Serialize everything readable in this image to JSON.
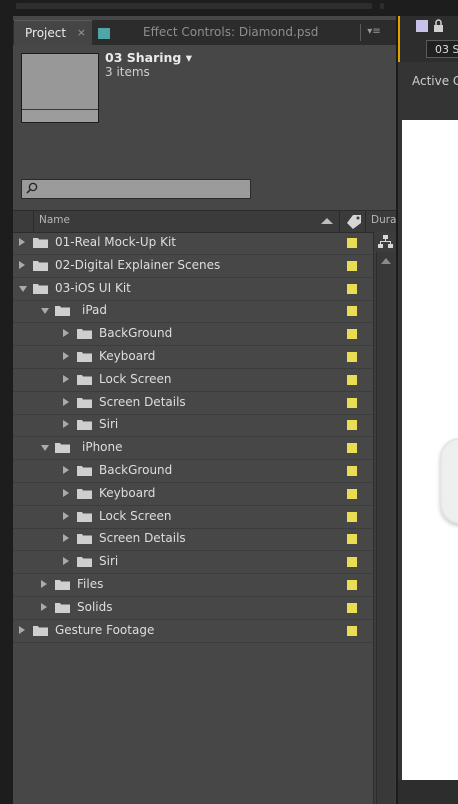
{
  "tabs": {
    "project": "Project",
    "project_close": "×",
    "effect_controls": "Effect Controls: Diamond.psd",
    "menu": "▾≡"
  },
  "composition": {
    "name": "03 Sharing ▾",
    "items": "3 items"
  },
  "search": {
    "placeholder": ""
  },
  "columns": {
    "name": "Name",
    "duration": "Dura"
  },
  "rows": [
    {
      "label": "01-Real Mock-Up Kit",
      "level": 0,
      "expanded": false
    },
    {
      "label": "02-Digital Explainer Scenes",
      "level": 0,
      "expanded": false
    },
    {
      "label": "03-iOS UI Kit",
      "level": 0,
      "expanded": true
    },
    {
      "label": "iPad",
      "level": 1,
      "expanded": true
    },
    {
      "label": "BackGround",
      "level": 2,
      "expanded": false
    },
    {
      "label": "Keyboard",
      "level": 2,
      "expanded": false
    },
    {
      "label": "Lock Screen",
      "level": 2,
      "expanded": false
    },
    {
      "label": "Screen Details",
      "level": 2,
      "expanded": false
    },
    {
      "label": "Siri",
      "level": 2,
      "expanded": false
    },
    {
      "label": "iPhone",
      "level": 1,
      "expanded": true
    },
    {
      "label": "BackGround",
      "level": 2,
      "expanded": false
    },
    {
      "label": "Keyboard",
      "level": 2,
      "expanded": false
    },
    {
      "label": "Lock Screen",
      "level": 2,
      "expanded": false
    },
    {
      "label": "Screen Details",
      "level": 2,
      "expanded": false
    },
    {
      "label": "Siri",
      "level": 2,
      "expanded": false
    },
    {
      "label": "Files",
      "level": 1,
      "expanded": false
    },
    {
      "label": "Solids",
      "level": 1,
      "expanded": false
    },
    {
      "label": "Gesture Footage",
      "level": 0,
      "expanded": false
    }
  ],
  "label_color": "#e8dd55",
  "viewer": {
    "comp_tab": "03 S",
    "active_camera": "Active C"
  },
  "icons": [
    "search-icon",
    "folder-icon",
    "label-tag-icon",
    "flowchart-icon",
    "lock-icon",
    "sort-ascending-icon",
    "panel-menu-icon"
  ]
}
